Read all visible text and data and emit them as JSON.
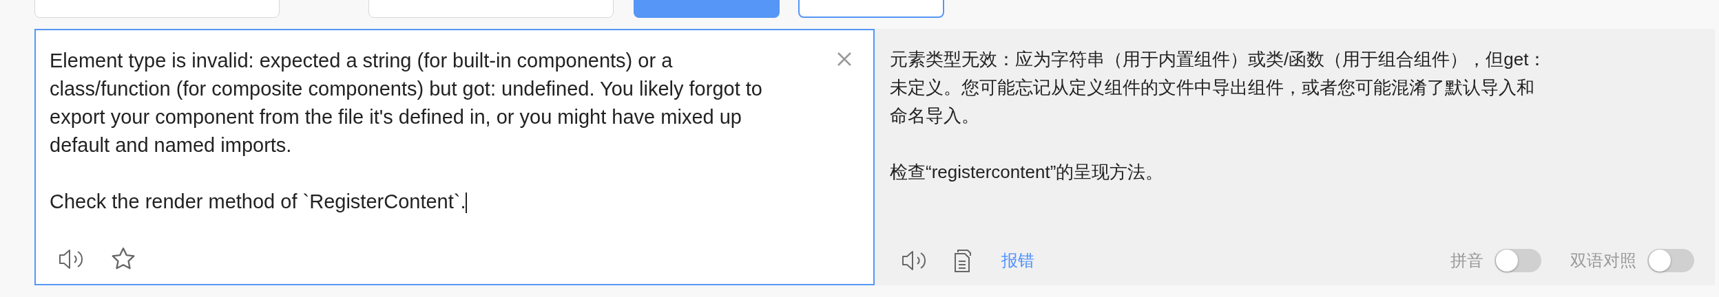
{
  "source": {
    "text": "Element type is invalid: expected a string (for built-in components) or a class/function (for composite components) but got: undefined. You likely forgot to export your component from the file it's defined in, or you might have mixed up default and named imports.\n\nCheck the render method of `RegisterContent`."
  },
  "result": {
    "paragraphs": [
      "元素类型无效：应为字符串（用于内置组件）或类/函数（用于组合组件），但get：未定义。您可能忘记从定义组件的文件中导出组件，或者您可能混淆了默认导入和命名导入。",
      "检查“registercontent”的呈现方法。"
    ],
    "report_link": "报错"
  },
  "toggles": [
    {
      "label": "拼音",
      "on": false
    },
    {
      "label": "双语对照",
      "on": false
    }
  ]
}
